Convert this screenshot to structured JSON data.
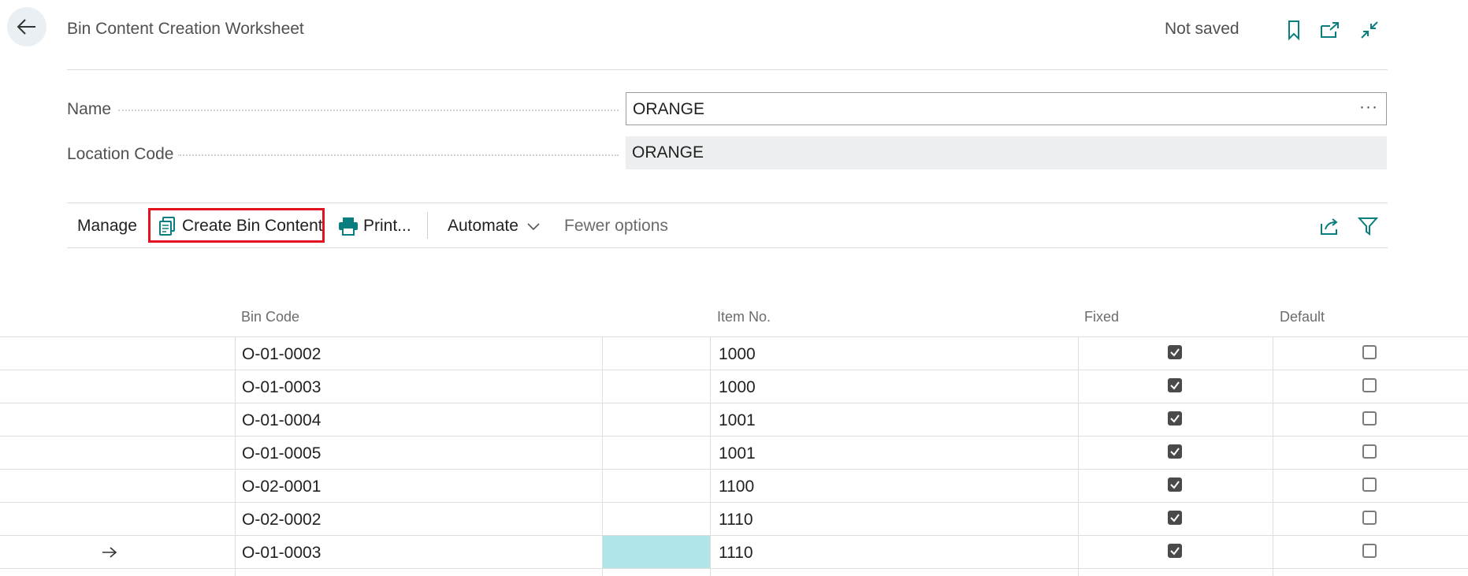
{
  "header": {
    "title": "Bin Content Creation Worksheet",
    "status": "Not saved"
  },
  "fields": {
    "name": {
      "label": "Name",
      "value": "ORANGE"
    },
    "location_code": {
      "label": "Location Code",
      "value": "ORANGE"
    }
  },
  "actions": {
    "manage": "Manage",
    "create_bin_content": "Create Bin Content",
    "print": "Print...",
    "automate": "Automate",
    "fewer_options": "Fewer options"
  },
  "table": {
    "columns": {
      "bin_code": "Bin Code",
      "item_no": "Item No.",
      "fixed": "Fixed",
      "default": "Default"
    },
    "rows": [
      {
        "bin_code": "O-01-0002",
        "item_no": "1000",
        "fixed": true,
        "default": false
      },
      {
        "bin_code": "O-01-0003",
        "item_no": "1000",
        "fixed": true,
        "default": false
      },
      {
        "bin_code": "O-01-0004",
        "item_no": "1001",
        "fixed": true,
        "default": false
      },
      {
        "bin_code": "O-01-0005",
        "item_no": "1001",
        "fixed": true,
        "default": false
      },
      {
        "bin_code": "O-02-0001",
        "item_no": "1100",
        "fixed": true,
        "default": false
      },
      {
        "bin_code": "O-02-0002",
        "item_no": "1110",
        "fixed": true,
        "default": false
      },
      {
        "bin_code": "O-01-0003",
        "item_no": "1110",
        "fixed": true,
        "default": false,
        "current": true
      }
    ]
  },
  "colors": {
    "accent": "#0a7e7e",
    "highlight_border": "#e0141e",
    "selected_cell": "#b0e6ea"
  }
}
